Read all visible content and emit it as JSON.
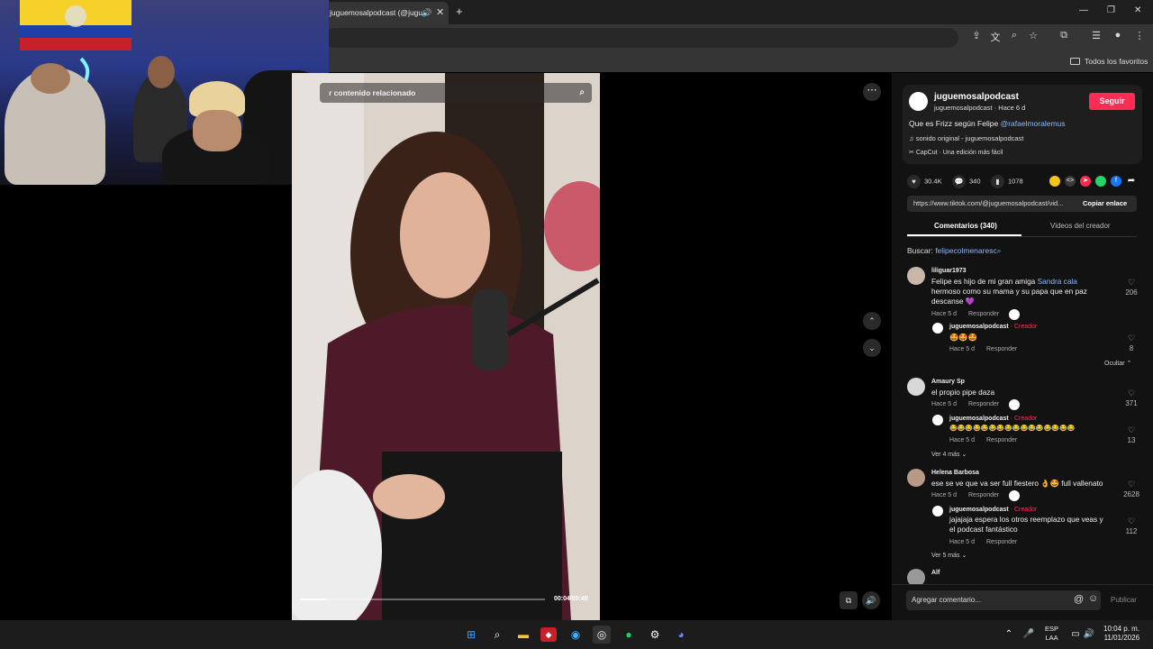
{
  "browser": {
    "tab_title": "juguemosalpodcast (@jugu",
    "new_tab": "+",
    "bookmarks_label": "Todos los favoritos"
  },
  "video": {
    "search_placeholder": "r contenido relacionado",
    "time": "00:04/00:40",
    "progress": 0.11
  },
  "post": {
    "creator": "juguemosalpodcast",
    "creator_sub": "juguemosalpodcast · Hace 6 d",
    "follow": "Seguir",
    "caption": "Que es Frizz según Felipe ",
    "caption_mention": "@rafaelmoralemus",
    "sound": "sonido original - juguemosalpodcast",
    "capcut": "CapCut · Una edición más fácil",
    "likes": "30.4K",
    "comments": "340",
    "saves": "1078",
    "link": "https://www.tiktok.com/@juguemosalpodcast/vid...",
    "copy_link": "Copiar enlace",
    "tab_comments": "Comentarios (340)",
    "tab_videos": "Videos del creador",
    "search_label": "Buscar: ",
    "search_query": "felipecolmenaresc"
  },
  "comments": [
    {
      "user": "liliguar1973",
      "text_a": "Felipe es hijo de mi gran amiga ",
      "mention": "Sandra cala",
      "text_b": "hermoso como su mama y su papa que en paz",
      "text_c": "descanse 💜",
      "time": "Hace 5 d",
      "reply": "Responder",
      "likes": "206",
      "sub_user": "juguemosalpodcast",
      "sub_tag": " · Creador",
      "sub_text": "🤩🤩🤩",
      "sub_time": "Hace 5 d",
      "sub_reply": "Responder",
      "sub_likes": "8",
      "toggle": "Ocultar ⌃"
    },
    {
      "user": "Amaury Sp",
      "text_a": "el propio pipe daza",
      "time": "Hace 5 d",
      "reply": "Responder",
      "likes": "371",
      "sub_user": "juguemosalpodcast",
      "sub_tag": " · Creador",
      "sub_text": "😂😂😂😂😂😂😂😂😂😂😂😂😂😂😂😂",
      "sub_time": "Hace 5 d",
      "sub_reply": "Responder",
      "sub_likes": "13",
      "toggle": "Ver 4 más ⌄"
    },
    {
      "user": "Helena Barbosa",
      "text_a": "ese se ve que va ser full fiestero 👌🤩 full vallenato",
      "time": "Hace 5 d",
      "reply": "Responder",
      "likes": "2628",
      "sub_user": "juguemosalpodcast",
      "sub_tag": " · Creador",
      "sub_text": "jajajaja espera los otros reemplazo que veas y",
      "sub_text2": "el podcast fantástico",
      "sub_time": "Hace 5 d",
      "sub_reply": "Responder",
      "sub_likes": "112",
      "toggle": "Ver 5 más ⌄"
    },
    {
      "user": "Alf"
    }
  ],
  "composer": {
    "placeholder": "Agregar comentario...",
    "publish": "Publicar"
  },
  "taskbar": {
    "lang_a": "ESP",
    "lang_b": "LAA",
    "time": "10:04 p. m.",
    "date": "11/01/2026"
  },
  "colors": {
    "accent": "#fe2c55",
    "mention": "#8fb8ff"
  }
}
